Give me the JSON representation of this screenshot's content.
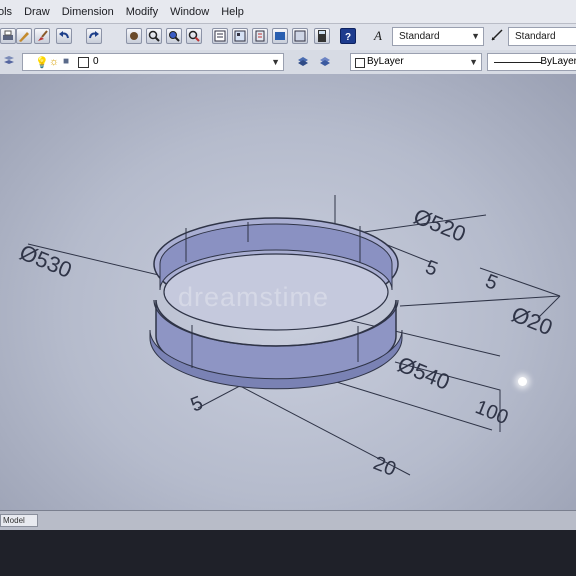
{
  "menubar": {
    "items": [
      "ols",
      "Draw",
      "Dimension",
      "Modify",
      "Window",
      "Help"
    ]
  },
  "toolbar": {
    "text_style": "Standard",
    "dim_style": "Standard"
  },
  "properties_bar": {
    "layer_value": "0",
    "color": "ByLayer",
    "linetype": "ByLayer"
  },
  "drawing": {
    "dimensions": {
      "d530": "Ø530",
      "d520": "Ø520",
      "d540": "Ø540",
      "d20": "Ø20",
      "five_top": "5",
      "five_right": "5",
      "five_left": "5",
      "height": "100",
      "base": "20"
    }
  },
  "watermark": "dreamstime",
  "status": {
    "model_tab": "Model"
  },
  "colors": {
    "canvas": "#c2c7d6",
    "ring": "#8d94c6",
    "lines": "#2f3447"
  }
}
